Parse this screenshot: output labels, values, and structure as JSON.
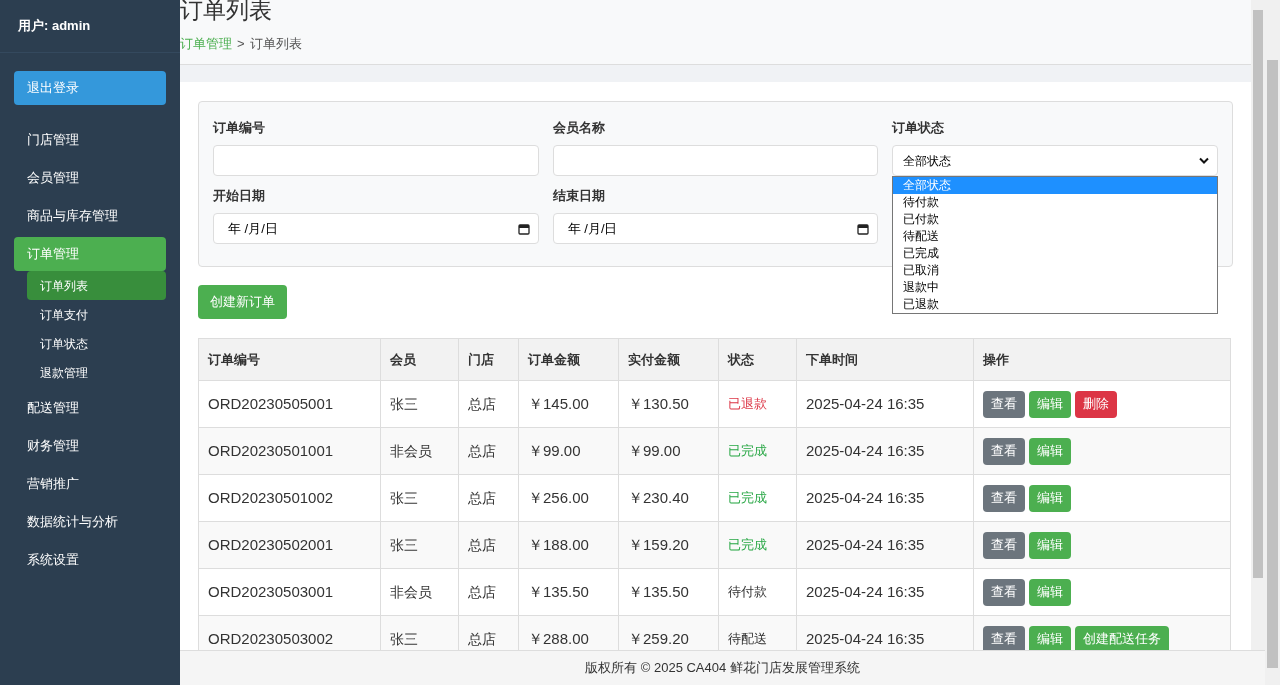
{
  "sidebar": {
    "user": "用户: admin",
    "logout": "退出登录",
    "items": [
      {
        "label": "门店管理",
        "selected": false
      },
      {
        "label": "会员管理",
        "selected": false
      },
      {
        "label": "商品与库存管理",
        "selected": false
      },
      {
        "label": "订单管理",
        "selected": true,
        "children": [
          {
            "label": "订单列表",
            "selected": true
          },
          {
            "label": "订单支付",
            "selected": false
          },
          {
            "label": "订单状态",
            "selected": false
          },
          {
            "label": "退款管理",
            "selected": false
          }
        ]
      },
      {
        "label": "配送管理",
        "selected": false
      },
      {
        "label": "财务管理",
        "selected": false
      },
      {
        "label": "营销推广",
        "selected": false
      },
      {
        "label": "数据统计与分析",
        "selected": false
      },
      {
        "label": "系统设置",
        "selected": false
      }
    ]
  },
  "header": {
    "title": "订单列表",
    "breadcrumb": [
      "订单管理",
      "订单列表"
    ],
    "separator": ">"
  },
  "filter_rows": [
    {
      "fields": [
        {
          "kind": "text",
          "label": "订单编号"
        },
        {
          "kind": "text",
          "label": "会员名称"
        },
        {
          "kind": "select",
          "label": "订单状态",
          "value": "全部状态",
          "options": [
            {
              "label": "全部状态",
              "selected": true
            },
            {
              "label": "待付款",
              "selected": false
            },
            {
              "label": "已付款",
              "selected": false
            },
            {
              "label": "待配送",
              "selected": false
            },
            {
              "label": "已完成",
              "selected": false
            },
            {
              "label": "已取消",
              "selected": false
            },
            {
              "label": "退款中",
              "selected": false
            },
            {
              "label": "已退款",
              "selected": false
            }
          ]
        }
      ]
    },
    {
      "fields": [
        {
          "kind": "date",
          "label": "开始日期",
          "value": "年 /月/日"
        },
        {
          "kind": "date",
          "label": "结束日期",
          "value": "年 /月/日"
        }
      ]
    }
  ],
  "create_button": "创建新订单",
  "table": {
    "columns": [
      "订单编号",
      "会员",
      "门店",
      "订单金额",
      "实付金额",
      "状态",
      "下单时间",
      "操作"
    ],
    "rows": [
      {
        "id": "ORD20230505001",
        "member": "张三",
        "store": "总店",
        "amount": "￥145.00",
        "paid": "￥130.50",
        "status": "已退款",
        "kind": "refunded",
        "time": "2025-04-24 16:35",
        "actions": [
          {
            "kind": "view",
            "label": "查看"
          },
          {
            "kind": "edit",
            "label": "编辑"
          },
          {
            "kind": "delete",
            "label": "删除"
          }
        ]
      },
      {
        "id": "ORD20230501001",
        "member": "非会员",
        "store": "总店",
        "amount": "￥99.00",
        "paid": "￥99.00",
        "status": "已完成",
        "kind": "completed",
        "time": "2025-04-24 16:35",
        "actions": [
          {
            "kind": "view",
            "label": "查看"
          },
          {
            "kind": "edit",
            "label": "编辑"
          }
        ]
      },
      {
        "id": "ORD20230501002",
        "member": "张三",
        "store": "总店",
        "amount": "￥256.00",
        "paid": "￥230.40",
        "status": "已完成",
        "kind": "completed",
        "time": "2025-04-24 16:35",
        "actions": [
          {
            "kind": "view",
            "label": "查看"
          },
          {
            "kind": "edit",
            "label": "编辑"
          }
        ]
      },
      {
        "id": "ORD20230502001",
        "member": "张三",
        "store": "总店",
        "amount": "￥188.00",
        "paid": "￥159.20",
        "status": "已完成",
        "kind": "completed",
        "time": "2025-04-24 16:35",
        "actions": [
          {
            "kind": "view",
            "label": "查看"
          },
          {
            "kind": "edit",
            "label": "编辑"
          }
        ]
      },
      {
        "id": "ORD20230503001",
        "member": "非会员",
        "store": "总店",
        "amount": "￥135.50",
        "paid": "￥135.50",
        "status": "待付款",
        "kind": "pending",
        "time": "2025-04-24 16:35",
        "actions": [
          {
            "kind": "view",
            "label": "查看"
          },
          {
            "kind": "edit",
            "label": "编辑"
          }
        ]
      },
      {
        "id": "ORD20230503002",
        "member": "张三",
        "store": "总店",
        "amount": "￥288.00",
        "paid": "￥259.20",
        "status": "待配送",
        "kind": "pending",
        "time": "2025-04-24 16:35",
        "actions": [
          {
            "kind": "view",
            "label": "查看"
          },
          {
            "kind": "edit",
            "label": "编辑"
          },
          {
            "kind": "create",
            "label": "创建配送任务"
          }
        ]
      }
    ]
  },
  "footer": "版权所有 © 2025 CA404 鲜花门店发展管理系统"
}
